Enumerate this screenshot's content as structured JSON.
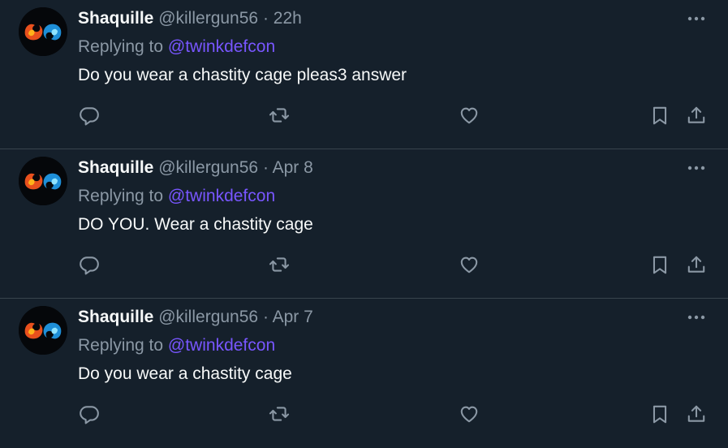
{
  "tweets": [
    {
      "display_name": "Shaquille",
      "handle": "@killergun56",
      "separator": "·",
      "time": "22h",
      "replying_to_label": "Replying to",
      "replying_to_handle": "@twinkdefcon",
      "text": "Do you wear a chastity cage pleas3 answer"
    },
    {
      "display_name": "Shaquille",
      "handle": "@killergun56",
      "separator": "·",
      "time": "Apr 8",
      "replying_to_label": "Replying to",
      "replying_to_handle": "@twinkdefcon",
      "text": "DO YOU. Wear a chastity cage"
    },
    {
      "display_name": "Shaquille",
      "handle": "@killergun56",
      "separator": "·",
      "time": "Apr 7",
      "replying_to_label": "Replying to",
      "replying_to_handle": "@twinkdefcon",
      "text": "Do you wear a chastity cage"
    }
  ],
  "icons": {
    "more": "more-dots-icon",
    "reply": "reply-icon",
    "retweet": "retweet-icon",
    "like": "heart-icon",
    "bookmark": "bookmark-icon",
    "share": "share-icon"
  },
  "colors": {
    "background": "#15202b",
    "text_primary": "#f7f9f9",
    "text_secondary": "#8b98a5",
    "mention": "#7856ff",
    "divider": "#38444d"
  }
}
